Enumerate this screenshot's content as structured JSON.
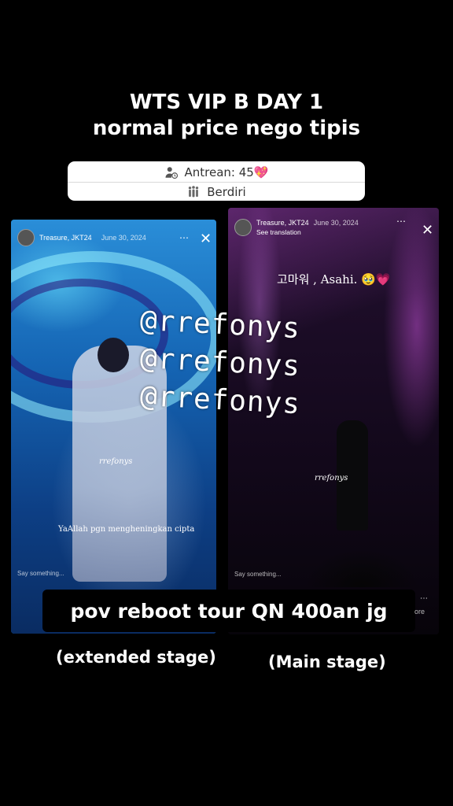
{
  "header": {
    "title_line1": "WTS VIP B DAY 1",
    "title_line2": "normal price nego tipis"
  },
  "info_card": {
    "queue_label": "Antrean: 45💖",
    "seat_label": "Berdiri",
    "queue_icon": "person-clock-icon",
    "seat_icon": "people-standing-icon"
  },
  "story_left": {
    "account": "Treasure, JKT24",
    "date": "June 30, 2024",
    "handle_small": "rrefonys",
    "caption": "YaAllah pgn mengheningkan cipta",
    "reply_placeholder": "Say something..."
  },
  "story_right": {
    "account": "Treasure, JKT24",
    "date": "June 30, 2024",
    "see_translation": "See translation",
    "caption": "고마워 , Asahi. 🥹💗",
    "handle_small": "rrefonys",
    "reply_placeholder": "Say something...",
    "more_text": "ore"
  },
  "watermark": {
    "line1": "@rrefonys",
    "line2": "@rrefonys",
    "line3": "@rrefonys"
  },
  "footer": {
    "pov_label": "pov reboot tour QN 400an jg",
    "left_stage": "(extended stage)",
    "right_stage": "(Main stage)"
  },
  "icons": {
    "more": "⋯",
    "close": "✕"
  }
}
